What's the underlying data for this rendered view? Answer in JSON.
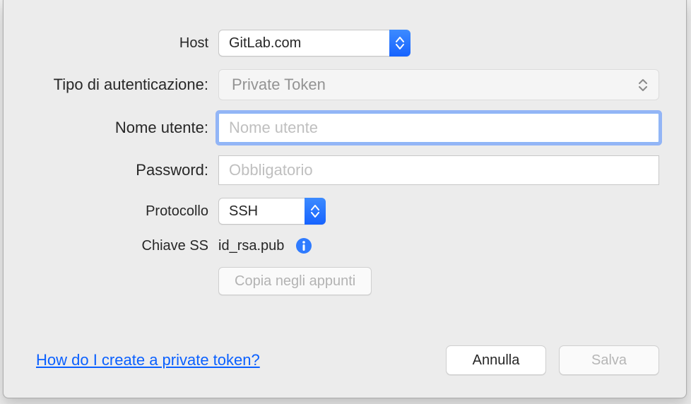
{
  "labels": {
    "host": "Host",
    "auth_type": "Tipo di autenticazione:",
    "username": "Nome utente:",
    "password": "Password:",
    "protocol": "Protocollo",
    "ssh_key": "Chiave SS"
  },
  "values": {
    "host_selected": "GitLab.com",
    "auth_type_selected": "Private Token",
    "username_value": "",
    "username_placeholder": "Nome utente",
    "password_value": "",
    "password_placeholder": "Obbligatorio",
    "protocol_selected": "SSH",
    "ssh_key_file": "id_rsa.pub"
  },
  "buttons": {
    "copy": "Copia negli appunti",
    "cancel": "Annulla",
    "save": "Salva"
  },
  "help_link": "How do I create a private token?",
  "colors": {
    "accent": "#1f6bff"
  }
}
